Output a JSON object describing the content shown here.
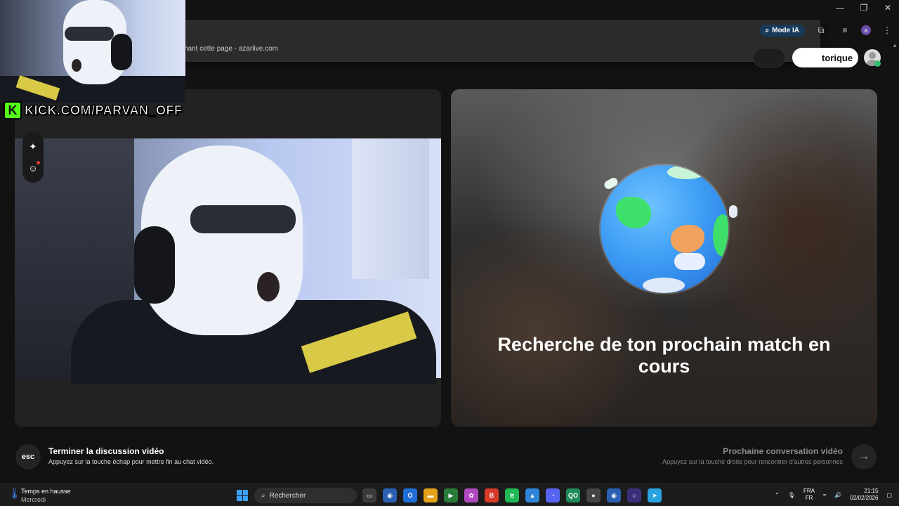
{
  "browser": {
    "omnibox_prefix": "hant cette page",
    "omnibox_sep": " - ",
    "omnibox_domain": "azarlive.com",
    "mode_ia_label": "Mode IA",
    "profile_initial": "a"
  },
  "header": {
    "history_label": "torique"
  },
  "match": {
    "searching_text": "Recherche de ton prochain match en cours"
  },
  "bottom": {
    "esc_key": "esc",
    "end_title": "Terminer la discussion vidéo",
    "end_sub": "Appuyez sur la touche échap pour mettre fin au chat vidéo.",
    "next_title": "Prochaine conversation vidéo",
    "next_sub": "Appuyez sur la touche droite pour rencontrer d'autres personnes"
  },
  "overlay": {
    "kick_logo": "K",
    "kick_text": "KICK.COM/PARVAN_OFF"
  },
  "taskbar": {
    "weather_title": "Temps en hausse",
    "weather_day": "Mercredi",
    "search_label": "Rechercher",
    "lang_top": "FRA",
    "lang_bottom": "FR",
    "time": "21:15",
    "date": "02/02/2026"
  },
  "colors": {
    "accent_kick": "#53fc18",
    "globe_blue": "#3f9ef5",
    "land_green": "#3ee06b",
    "land_orange": "#f2a25c"
  }
}
